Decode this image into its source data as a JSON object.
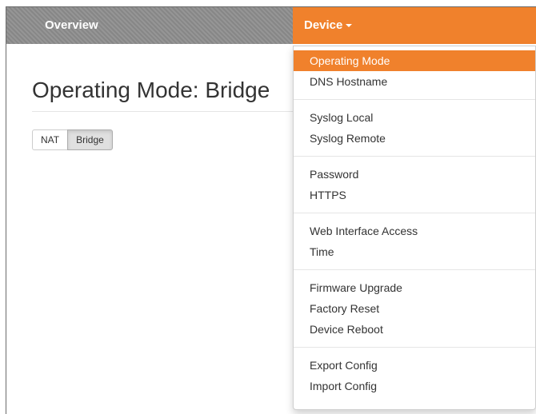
{
  "nav": {
    "overview_label": "Overview",
    "device_label": "Device"
  },
  "colors": {
    "accent": "#f0812c",
    "navbar": "#8c8c8c"
  },
  "page": {
    "title": "Operating Mode: Bridge"
  },
  "mode_toggle": {
    "options": [
      {
        "label": "NAT",
        "active": false
      },
      {
        "label": "Bridge",
        "active": true
      }
    ]
  },
  "dropdown": {
    "groups": [
      [
        {
          "label": "Operating Mode",
          "active": true
        },
        {
          "label": "DNS Hostname"
        }
      ],
      [
        {
          "label": "Syslog Local"
        },
        {
          "label": "Syslog Remote"
        }
      ],
      [
        {
          "label": "Password"
        },
        {
          "label": "HTTPS"
        }
      ],
      [
        {
          "label": "Web Interface Access"
        },
        {
          "label": "Time"
        }
      ],
      [
        {
          "label": "Firmware Upgrade"
        },
        {
          "label": "Factory Reset"
        },
        {
          "label": "Device Reboot"
        }
      ],
      [
        {
          "label": "Export Config"
        },
        {
          "label": "Import Config"
        }
      ]
    ]
  }
}
